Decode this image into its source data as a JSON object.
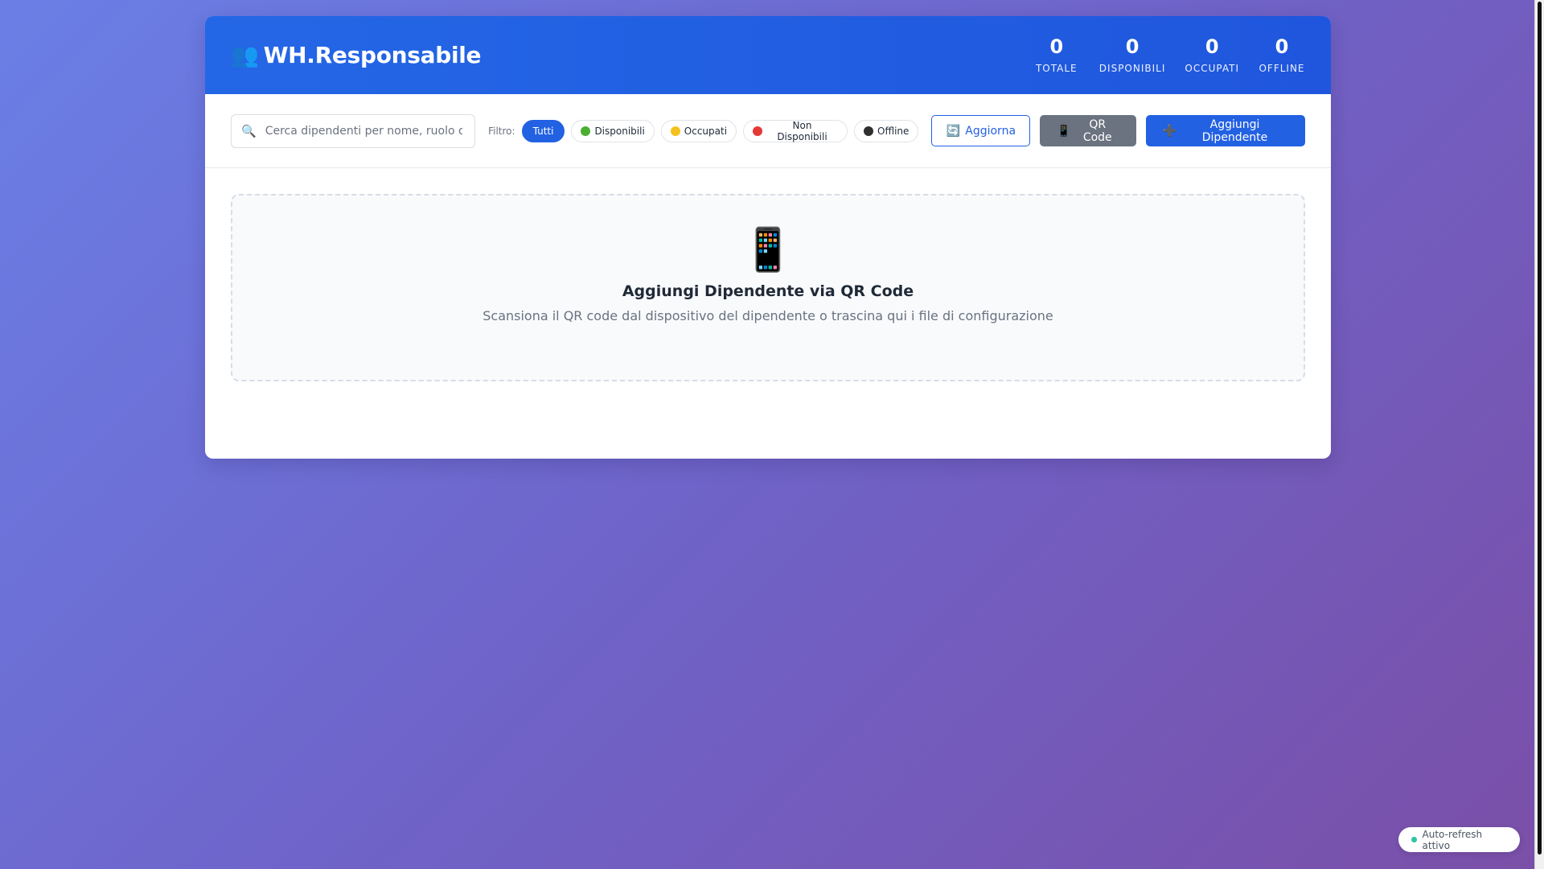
{
  "header": {
    "brand_icon": "👥",
    "brand_title": "WH.Responsabile",
    "stats": [
      {
        "value": "0",
        "label": "TOTALE"
      },
      {
        "value": "0",
        "label": "DISPONIBILI"
      },
      {
        "value": "0",
        "label": "OCCUPATI"
      },
      {
        "value": "0",
        "label": "OFFLINE"
      }
    ]
  },
  "toolbar": {
    "search_icon": "🔍",
    "search_placeholder": "Cerca dipendenti per nome, ruolo o ID...",
    "search_value": "",
    "filter_label": "Filtro:",
    "filters": [
      {
        "label": "Tutti",
        "active": true
      },
      {
        "label": "Disponibili",
        "dot": "green"
      },
      {
        "label": "Occupati",
        "dot": "yellow"
      },
      {
        "label": "Non Disponibili",
        "dot": "red"
      },
      {
        "label": "Offline",
        "dot": "black"
      }
    ],
    "refresh_icon": "🔄",
    "refresh_label": "Aggiorna",
    "qr_icon": "📱",
    "qr_label": "QR Code",
    "add_icon": "➕",
    "add_label": "Aggiungi Dipendente"
  },
  "dropzone": {
    "icon": "📱",
    "title": "Aggiungi Dipendente via QR Code",
    "subtitle": "Scansiona il QR code dal dispositivo del dipendente o trascina qui i file di configurazione"
  },
  "status": {
    "autorefresh_label": "Auto-refresh attivo"
  },
  "colors": {
    "header_blue": "#2361e3",
    "gray_button": "#6b7280",
    "live_dot": "#2ec4a4"
  }
}
